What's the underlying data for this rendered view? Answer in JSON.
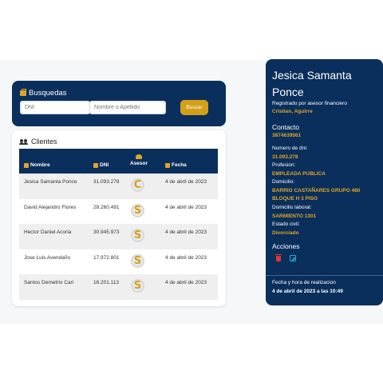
{
  "search": {
    "title": "Busquedas",
    "dni_placeholder": "DNI",
    "name_placeholder": "Nombre o Apellido",
    "button": "Buscar"
  },
  "clients": {
    "title": "Clientes",
    "headers": {
      "nombre": "Nombre",
      "dni": "DNI",
      "asesor": "Asesor",
      "fecha": "Fecha"
    },
    "rows": [
      {
        "nombre": "Jesica Samanta Ponce",
        "dni": "31.093.278",
        "asesor": "C",
        "fecha": "4 de abril de 2023"
      },
      {
        "nombre": "David Alejandro Flores",
        "dni": "28.260.491",
        "asesor": "S",
        "fecha": "4 de abril de 2023"
      },
      {
        "nombre": "Hector Daniel Acoria",
        "dni": "30.945.973",
        "asesor": "S",
        "fecha": "4 de abril de 2023"
      },
      {
        "nombre": "Jose Luis Avendaño",
        "dni": "17.972.801",
        "asesor": "S",
        "fecha": "4 de abril de 2023"
      },
      {
        "nombre": "Santos Demetrio Cari",
        "dni": "16.201.113",
        "asesor": "S",
        "fecha": "4 de abril de 2023"
      }
    ]
  },
  "detail": {
    "name": "Jesica Samanta Ponce",
    "registered_label": "Registrado por asesor financiero",
    "asesor": "Cristian, Aguirre",
    "contacto_title": "Contacto",
    "phone": "3874639561",
    "dni_label": "Numero de dni:",
    "dni": "31.093.278",
    "profesion_label": "Profesion:",
    "profesion": "EMPLEADA PUBLICA",
    "domicilio_label": "Domicilio:",
    "domicilio": "BARRIO CASTAÑARES GRUPO 480 BLOQUE H 3 PISO",
    "domicilio_laboral_label": "Domicilio laboral:",
    "domicilio_laboral": "SARMIENTO 1301",
    "estado_civil_label": "Estado civil:",
    "estado_civil": "Divorciado",
    "acciones_title": "Acciones",
    "fecha_label": "Fecha y hora de realizacion",
    "fecha": "4 de abril de 2023 a las 10:49"
  },
  "colors": {
    "navy": "#0a2f5c",
    "gold": "#e0a526",
    "delete": "#d93737",
    "edit": "#2aa7d6"
  }
}
